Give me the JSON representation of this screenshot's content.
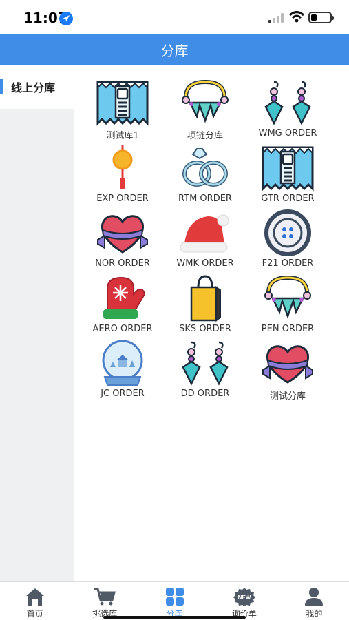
{
  "status": {
    "time": "11:07"
  },
  "header": {
    "title": "分库"
  },
  "sidebar": {
    "items": [
      {
        "label": "线上分库"
      }
    ]
  },
  "warehouses": [
    {
      "name": "测试库1",
      "icon": "zipper-icon"
    },
    {
      "name": "项链分库",
      "icon": "necklace-icon"
    },
    {
      "name": "WMG ORDER",
      "icon": "earrings-icon"
    },
    {
      "name": "EXP ORDER",
      "icon": "coin-charm-icon"
    },
    {
      "name": "RTM ORDER",
      "icon": "rings-icon"
    },
    {
      "name": "GTR ORDER",
      "icon": "zipper-icon"
    },
    {
      "name": "NOR ORDER",
      "icon": "heart-icon"
    },
    {
      "name": "WMK ORDER",
      "icon": "santa-hat-icon"
    },
    {
      "name": "F21 ORDER",
      "icon": "button-icon"
    },
    {
      "name": "AERO ORDER",
      "icon": "mitten-icon"
    },
    {
      "name": "SKS ORDER",
      "icon": "shopping-bag-icon"
    },
    {
      "name": "PEN ORDER",
      "icon": "necklace-icon"
    },
    {
      "name": "JC ORDER",
      "icon": "snow-globe-icon"
    },
    {
      "name": "DD ORDER",
      "icon": "earrings-icon"
    },
    {
      "name": "测试分库",
      "icon": "heart-icon"
    }
  ],
  "tabbar": {
    "tabs": [
      {
        "label": "首页",
        "icon": "home-icon"
      },
      {
        "label": "挑选库",
        "icon": "cart-icon"
      },
      {
        "label": "分库",
        "icon": "grid-icon"
      },
      {
        "label": "询价单",
        "icon": "new-badge-icon"
      },
      {
        "label": "我的",
        "icon": "user-icon"
      }
    ],
    "active": 2
  },
  "colors": {
    "accent": "#3f8de6",
    "sidebar_bg": "#eef0f1"
  }
}
